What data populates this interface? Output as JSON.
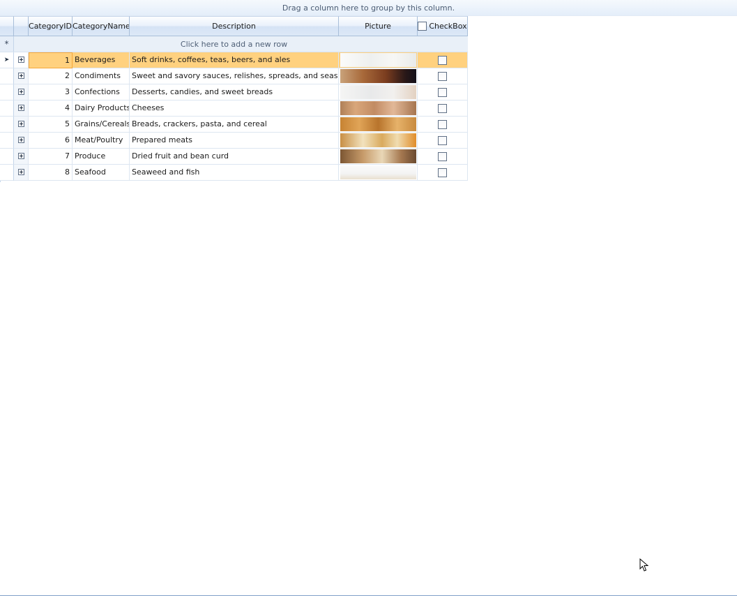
{
  "group_panel": {
    "text": "Drag a column here to group by this column."
  },
  "columns": {
    "category_id": "CategoryID",
    "category_name": "CategoryName",
    "description": "Description",
    "picture": "Picture",
    "checkbox": "CheckBox"
  },
  "new_row": {
    "indicator": "*",
    "text": "Click here to add a new row"
  },
  "rows": [
    {
      "id": "1",
      "name": "Beverages",
      "description": "Soft drinks, coffees, teas, beers, and ales",
      "picture": "beverages-photo",
      "checked": false,
      "selected": true
    },
    {
      "id": "2",
      "name": "Condiments",
      "description": "Sweet and savory sauces, relishes, spreads, and seasonings",
      "picture": "condiments-photo",
      "checked": false,
      "selected": false
    },
    {
      "id": "3",
      "name": "Confections",
      "description": "Desserts, candies, and sweet breads",
      "picture": "confections-photo",
      "checked": false,
      "selected": false
    },
    {
      "id": "4",
      "name": "Dairy Products",
      "description": "Cheeses",
      "picture": "dairy-products-photo",
      "checked": false,
      "selected": false
    },
    {
      "id": "5",
      "name": "Grains/Cereals",
      "description": "Breads, crackers, pasta, and cereal",
      "picture": "grains-cereals-photo",
      "checked": false,
      "selected": false
    },
    {
      "id": "6",
      "name": "Meat/Poultry",
      "description": "Prepared meats",
      "picture": "meat-poultry-photo",
      "checked": false,
      "selected": false
    },
    {
      "id": "7",
      "name": "Produce",
      "description": "Dried fruit and bean curd",
      "picture": "produce-photo",
      "checked": false,
      "selected": false
    },
    {
      "id": "8",
      "name": "Seafood",
      "description": "Seaweed and fish",
      "picture": "seafood-photo",
      "checked": false,
      "selected": false
    }
  ],
  "colors": {
    "selected_row": "#ffd17f",
    "header_border": "#a8bed9",
    "grid_line": "#dde6f1"
  },
  "icons": {
    "current_row": "current-row-arrow-icon",
    "expander": "plus-box-icon",
    "cursor": "mouse-pointer-icon"
  }
}
